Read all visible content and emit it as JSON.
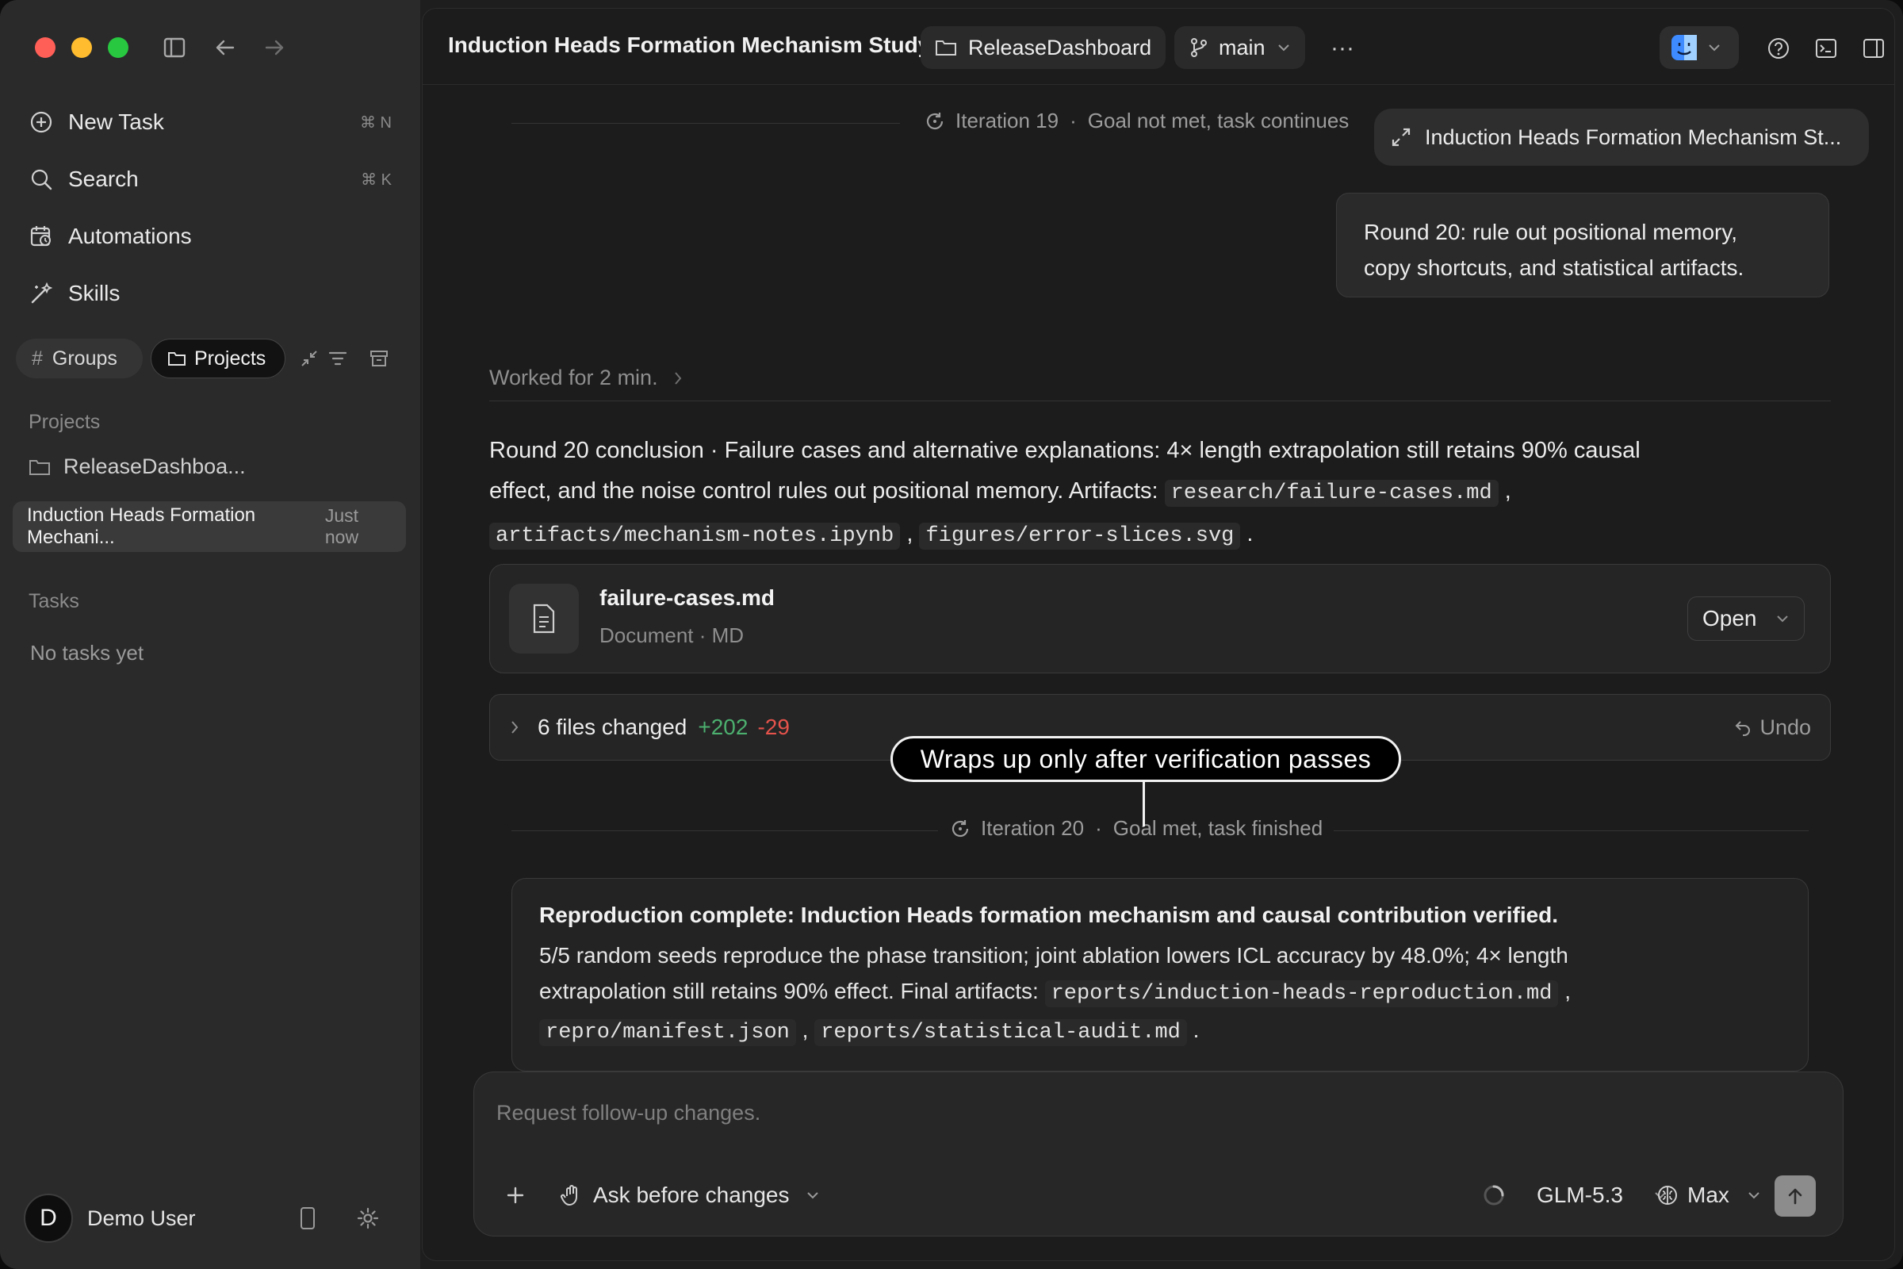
{
  "sidebar": {
    "nav": [
      {
        "label": "New Task",
        "shortcut": "⌘ N"
      },
      {
        "label": "Search",
        "shortcut": "⌘ K"
      },
      {
        "label": "Automations"
      },
      {
        "label": "Skills"
      }
    ],
    "chips": {
      "groups": "Groups",
      "projects": "Projects"
    },
    "projects_title": "Projects",
    "project_item": "ReleaseDashboa...",
    "task_item": {
      "title": "Induction Heads Formation Mechani...",
      "time": "Just now"
    },
    "tasks_title": "Tasks",
    "tasks_empty": "No tasks yet",
    "user": {
      "initial": "D",
      "name": "Demo User"
    }
  },
  "topbar": {
    "title": "Induction Heads Formation Mechanism Study",
    "folder": "ReleaseDashboard",
    "branch": "main",
    "more": "···"
  },
  "conversation": {
    "iteration19": {
      "label": "Iteration 19",
      "status": "Goal not met, task continues"
    },
    "expand_pill": "Induction Heads Formation Mechanism St...",
    "user_message_line1": "Round 20: rule out positional memory,",
    "user_message_line2": "copy shortcuts, and statistical artifacts.",
    "worked": "Worked for 2 min.",
    "conclusion_text1": "Round 20 conclusion · Failure cases and alternative explanations: 4× length extrapolation still retains 90% causal effect, and the noise control rules out positional memory. Artifacts: ",
    "artifact1": "research/failure-cases.md",
    "artifact2": "artifacts/mechanism-notes.ipynb",
    "artifact3": "figures/error-slices.svg",
    "comma": ",",
    "period": ".",
    "file_card": {
      "name": "failure-cases.md",
      "meta": "Document · MD",
      "open": "Open"
    },
    "changes": {
      "label": "6 files changed",
      "added": "+202",
      "removed": "-29",
      "undo": "Undo"
    },
    "callout": "Wraps up only after verification passes",
    "iteration20": {
      "label": "Iteration 20",
      "status": "Goal met, task finished"
    },
    "result": {
      "title": "Reproduction complete: Induction Heads formation mechanism and causal contribution verified.",
      "body_line1": "5/5 random seeds reproduce the phase transition; joint ablation lowers ICL accuracy by 48.0%; 4× length",
      "body_line2": "extrapolation still retains 90% effect. Final artifacts: ",
      "artifact1": "reports/induction-heads-reproduction.md",
      "artifact2": "repro/manifest.json",
      "artifact3": "reports/statistical-audit.md"
    }
  },
  "composer": {
    "placeholder": "Request follow-up changes.",
    "mode": "Ask before changes",
    "model": "GLM-5.3",
    "effort": "Max"
  },
  "colors": {
    "added": "#4caf6e",
    "removed": "#e5534b",
    "traffic_red": "#ff5f57",
    "traffic_yellow": "#febc2e",
    "traffic_green": "#28c840"
  }
}
